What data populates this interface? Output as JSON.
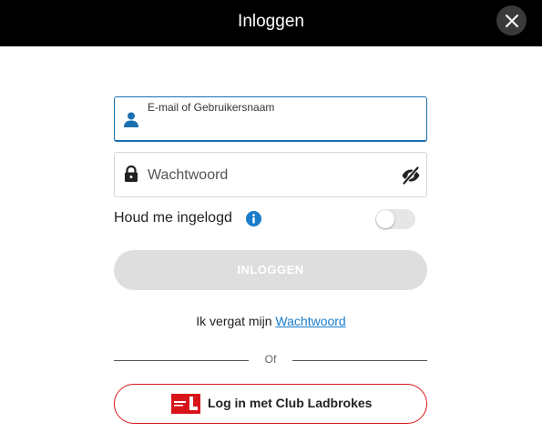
{
  "header": {
    "title": "Inloggen",
    "background": "#000000"
  },
  "close_button": {
    "icon": "close-icon"
  },
  "email_field": {
    "label": "E-mail of Gebruikersnaam",
    "value": "",
    "icon": "user-icon",
    "border_color": "#1a6fb0"
  },
  "password_field": {
    "placeholder": "Wachtwoord",
    "value": "",
    "icon": "lock-icon",
    "visibility_icon": "eye-slash-icon"
  },
  "remember_me": {
    "label": "Houd me ingelogd",
    "info_icon": "info-icon",
    "enabled": false
  },
  "login_button": {
    "label": "INLOGGEN",
    "disabled": true
  },
  "forgot": {
    "prefix": "Ik vergat mijn",
    "link": "Wachtwoord",
    "link_color": "#1a7cc9"
  },
  "divider": {
    "text": "Of"
  },
  "club_login": {
    "label": "Log in met Club Ladbrokes",
    "logo": "club-ladbrokes-logo",
    "accent": "#d8141b"
  }
}
